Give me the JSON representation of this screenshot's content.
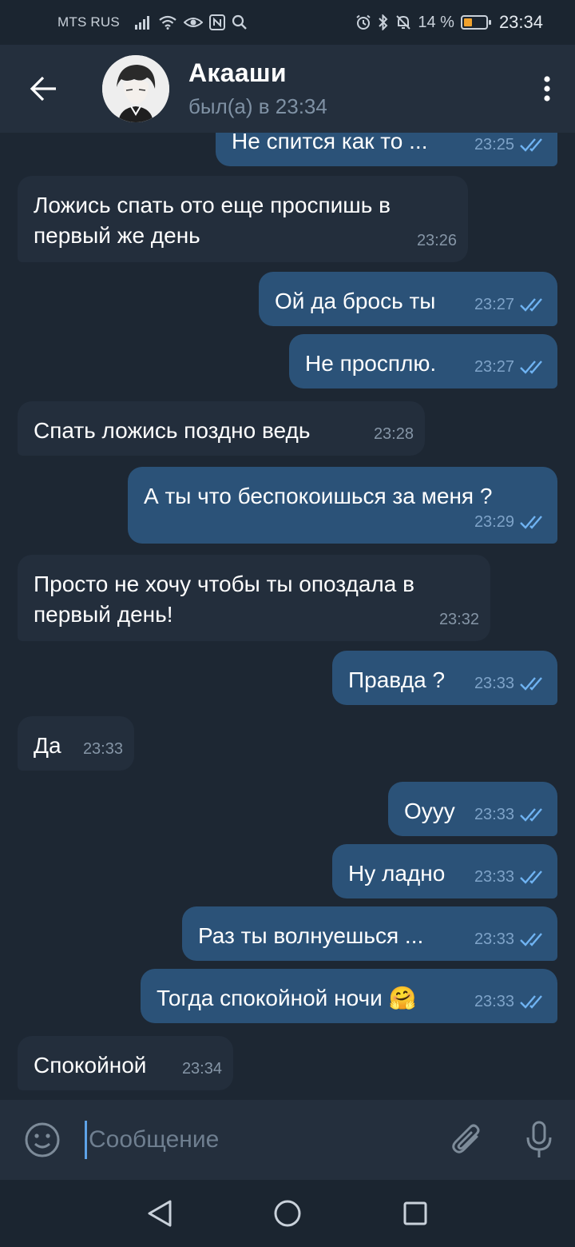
{
  "status_bar": {
    "carrier": "MTS RUS",
    "battery_percent": "14 %",
    "time": "23:34",
    "icons": [
      "signal-icon",
      "wifi-icon",
      "eye-icon",
      "nfc-icon",
      "search-icon",
      "alarm-icon",
      "bluetooth-icon",
      "mute-icon",
      "battery-icon"
    ]
  },
  "header": {
    "name": "Акааши",
    "status": "был(а) в 23:34"
  },
  "messages": [
    {
      "dir": "out",
      "text": "Не спится как то ...",
      "time": "23:25",
      "read": true
    },
    {
      "dir": "in",
      "text": "Ложись спать ото еще проспишь в первый же день",
      "time": "23:26"
    },
    {
      "dir": "out",
      "text": "Ой да брось ты",
      "time": "23:27",
      "read": true
    },
    {
      "dir": "out",
      "text": "Не просплю.",
      "time": "23:27",
      "read": true
    },
    {
      "dir": "in",
      "text": "Спать ложись поздно ведь",
      "time": "23:28"
    },
    {
      "dir": "out",
      "text": "А ты что беспокоишься за меня ?",
      "time": "23:29",
      "read": true
    },
    {
      "dir": "in",
      "text": "Просто не хочу чтобы ты опоздала в первый день!",
      "time": "23:32"
    },
    {
      "dir": "out",
      "text": "Правда ?",
      "time": "23:33",
      "read": true
    },
    {
      "dir": "in",
      "text": "Да",
      "time": "23:33"
    },
    {
      "dir": "out",
      "text": "Оууу",
      "time": "23:33",
      "read": true
    },
    {
      "dir": "out",
      "text": "Ну ладно",
      "time": "23:33",
      "read": true
    },
    {
      "dir": "out",
      "text": "Раз ты волнуешься ...",
      "time": "23:33",
      "read": true
    },
    {
      "dir": "out",
      "text": "Тогда спокойной ночи 🤗",
      "time": "23:33",
      "read": true
    },
    {
      "dir": "in",
      "text": "Спокойной",
      "time": "23:34"
    }
  ],
  "input": {
    "placeholder": "Сообщение",
    "value": ""
  },
  "colors": {
    "background": "#1d2733",
    "header": "#242f3d",
    "bubble_in": "#232e3c",
    "bubble_out": "#2b5278",
    "accent": "#5ea3e8"
  }
}
